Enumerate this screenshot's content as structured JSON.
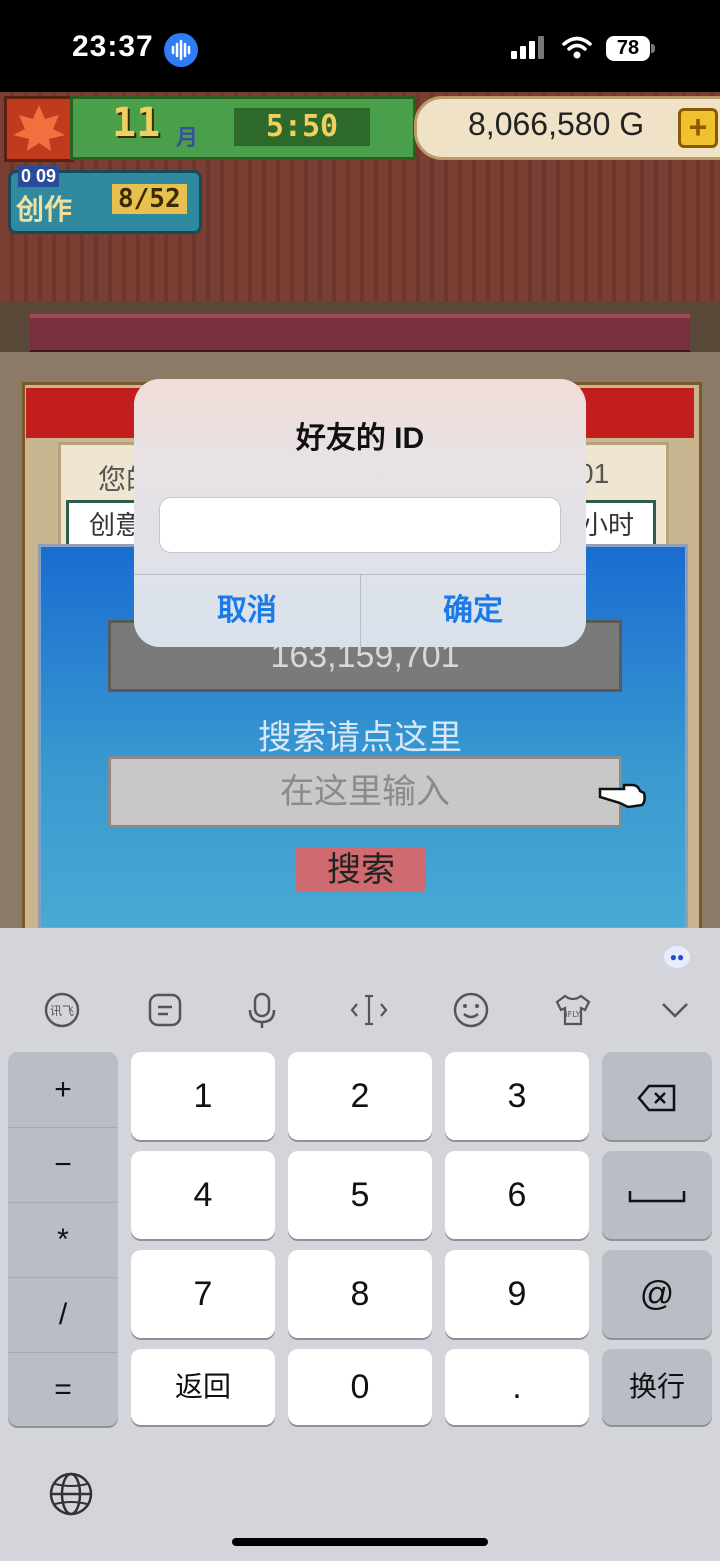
{
  "status_bar": {
    "time": "23:37",
    "battery": "78"
  },
  "hud": {
    "month_number": "11",
    "month_unit": "月",
    "clock": "5:50",
    "gold": "8,066,580 G",
    "create_small": "0 09",
    "create_label": "创作",
    "create_count": "8/52"
  },
  "background_card": {
    "text_left": "您的",
    "text_right": "01",
    "row_left": "创意",
    "row_right": "小时"
  },
  "search_panel": {
    "my_id": "163,159,701",
    "search_hint": "搜索请点这里",
    "input_placeholder": "在这里输入",
    "search_button": "搜索"
  },
  "alert": {
    "title": "好友的 ID",
    "input_value": "",
    "cancel": "取消",
    "confirm": "确定"
  },
  "keyboard": {
    "toolbar": [
      "讯飞",
      "表情文字",
      "语音",
      "光标",
      "表情",
      "皮肤",
      "收起"
    ],
    "symbols": [
      "+",
      "−",
      "*",
      "/",
      "="
    ],
    "rows": [
      [
        "1",
        "2",
        "3"
      ],
      [
        "4",
        "5",
        "6"
      ],
      [
        "7",
        "8",
        "9"
      ],
      [
        "返回",
        "0",
        "."
      ]
    ],
    "right_keys": [
      "⌫",
      "␣",
      "@",
      "换行"
    ]
  }
}
